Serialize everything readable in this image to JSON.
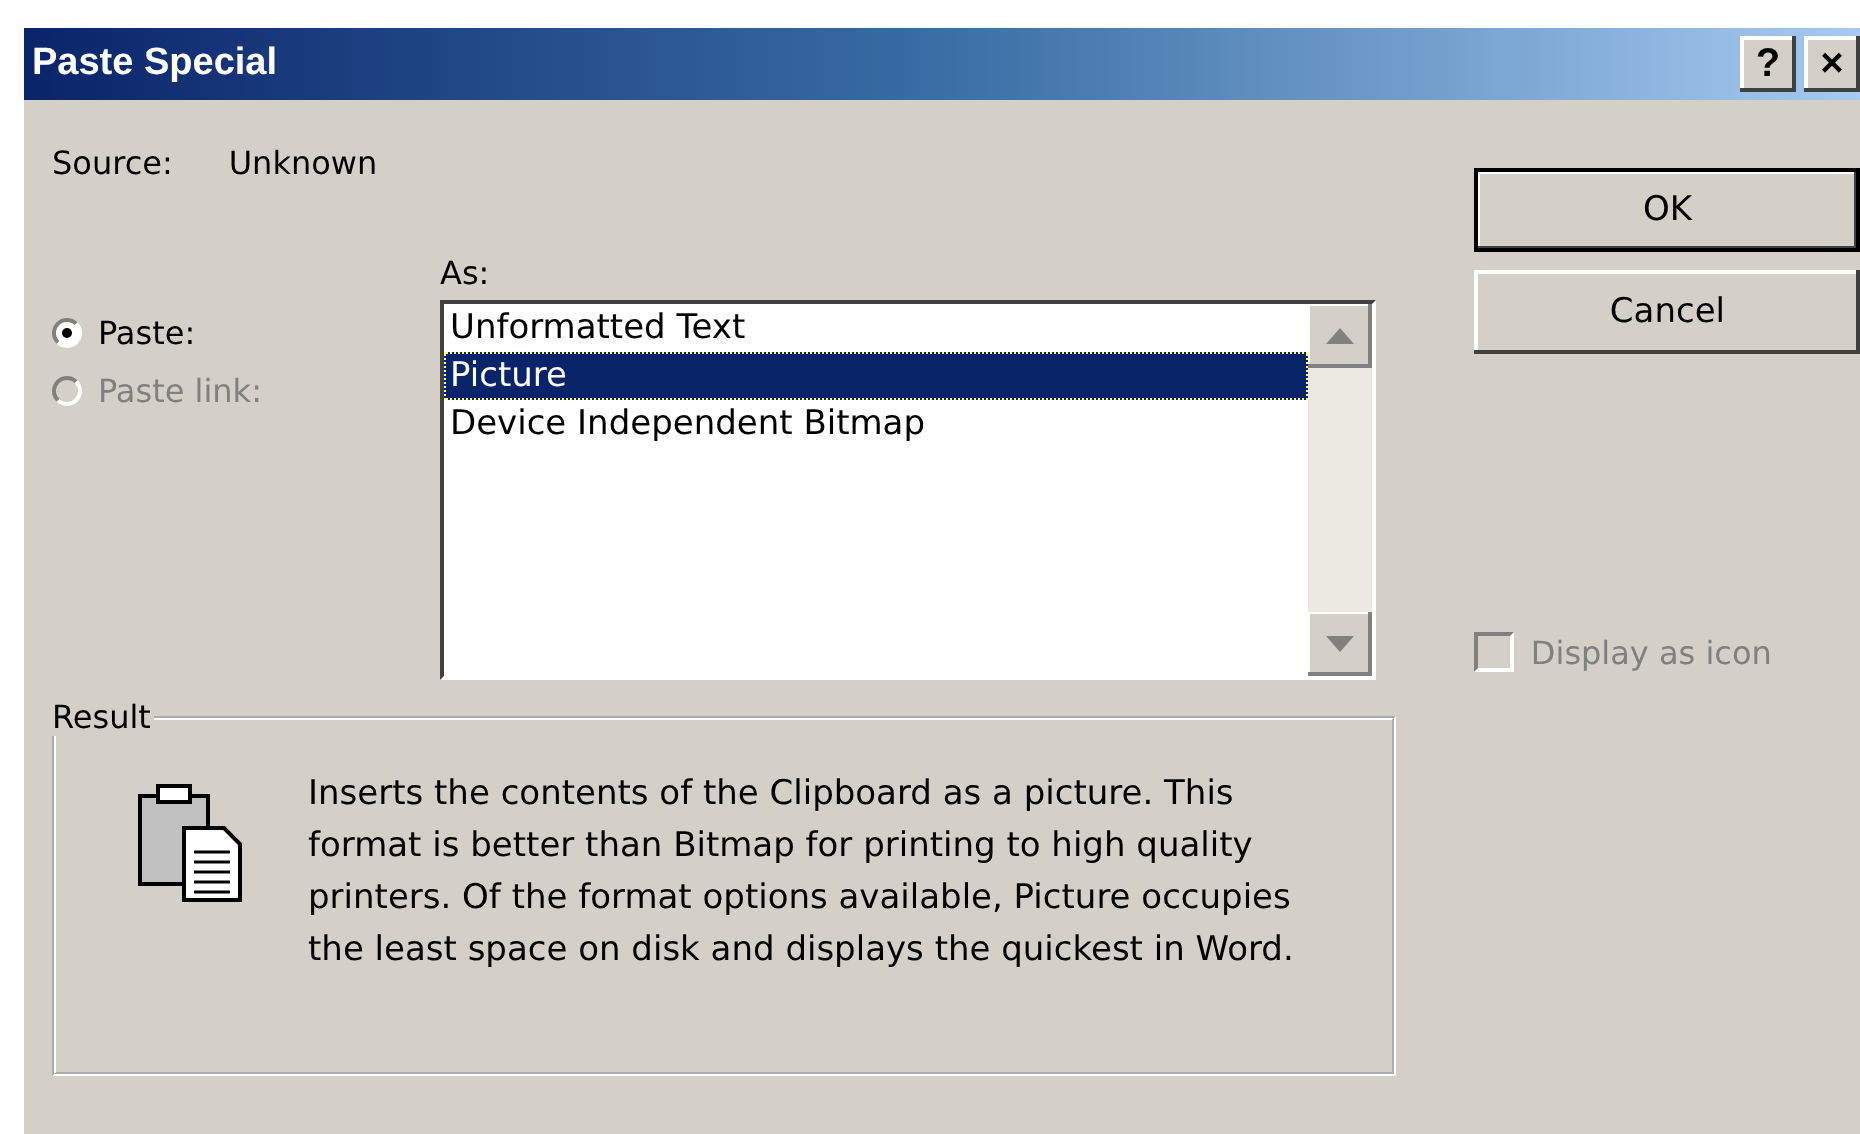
{
  "window": {
    "title": "Paste Special",
    "title_buttons": [
      "?",
      "×"
    ]
  },
  "source": {
    "label": "Source:",
    "value": "Unknown"
  },
  "paste_options": [
    {
      "label": "Paste:",
      "selected": true,
      "disabled": false
    },
    {
      "label": "Paste link:",
      "selected": false,
      "disabled": true
    }
  ],
  "as_list": {
    "label": "As:",
    "items": [
      {
        "label": "Unformatted Text",
        "selected": false
      },
      {
        "label": "Picture",
        "selected": true
      },
      {
        "label": "Device Independent Bitmap",
        "selected": false
      }
    ]
  },
  "buttons": [
    {
      "label": "OK",
      "default": true
    },
    {
      "label": "Cancel",
      "default": false
    }
  ],
  "display_as_icon": {
    "label": "Display as icon",
    "checked": false,
    "disabled": true
  },
  "result": {
    "title": "Result",
    "text": "Inserts the contents of the Clipboard as a picture. This format is better than Bitmap for printing to high quality printers. Of the format options available, Picture occupies the least space on disk and displays the quickest in Word."
  }
}
